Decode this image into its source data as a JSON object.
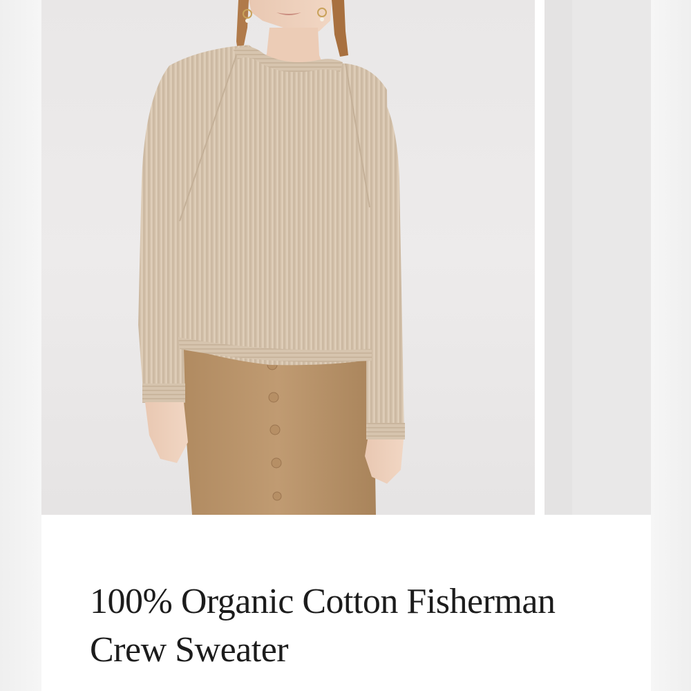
{
  "product": {
    "name": "100% Organic Cotton Fisherman Crew Sweater"
  },
  "gallery": {
    "images": [
      {
        "description_icon": "model-wearing-sweater-photo",
        "colors": {
          "sweater": "#d9c7b1",
          "skirt": "#b8926a",
          "background": "#ebe9e9"
        }
      },
      {
        "description_icon": "next-product-photo-partial",
        "colors": {
          "background": "#e8e7e7"
        }
      }
    ]
  }
}
